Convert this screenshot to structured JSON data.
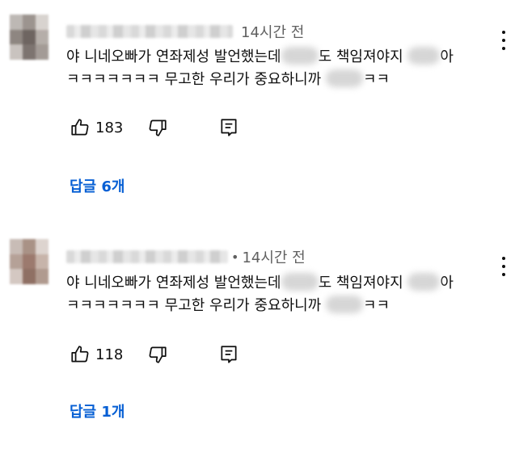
{
  "comments": [
    {
      "time": "14시간 전",
      "dot": "",
      "line1_a": "야 니네오빠가 연좌제성 발언했는데",
      "line1_b": "도 책임져야지",
      "line1_c": "아",
      "line2_a": "ㅋㅋㅋㅋㅋㅋㅋ 무고한 우리가 중요하니까",
      "line2_b": "ㅋㅋ",
      "likes": "183",
      "replies_label": "답글 6개"
    },
    {
      "time": "14시간 전",
      "dot": "•",
      "line1_a": "야 니네오빠가 연좌제성 발언했는데",
      "line1_b": "도 책임져야지",
      "line1_c": "아",
      "line2_a": "ㅋㅋㅋㅋㅋㅋㅋ 무고한 우리가 중요하니까",
      "line2_b": "ㅋㅋ",
      "likes": "118",
      "replies_label": "답글 1개"
    }
  ],
  "icons": {
    "like": "thumb-up-icon",
    "dislike": "thumb-down-icon",
    "reply": "reply-comment-icon",
    "menu": "more-vertical-icon"
  },
  "colors": {
    "accent": "#065fd4",
    "secondary_text": "#606060",
    "primary_text": "#0f0f0f"
  }
}
